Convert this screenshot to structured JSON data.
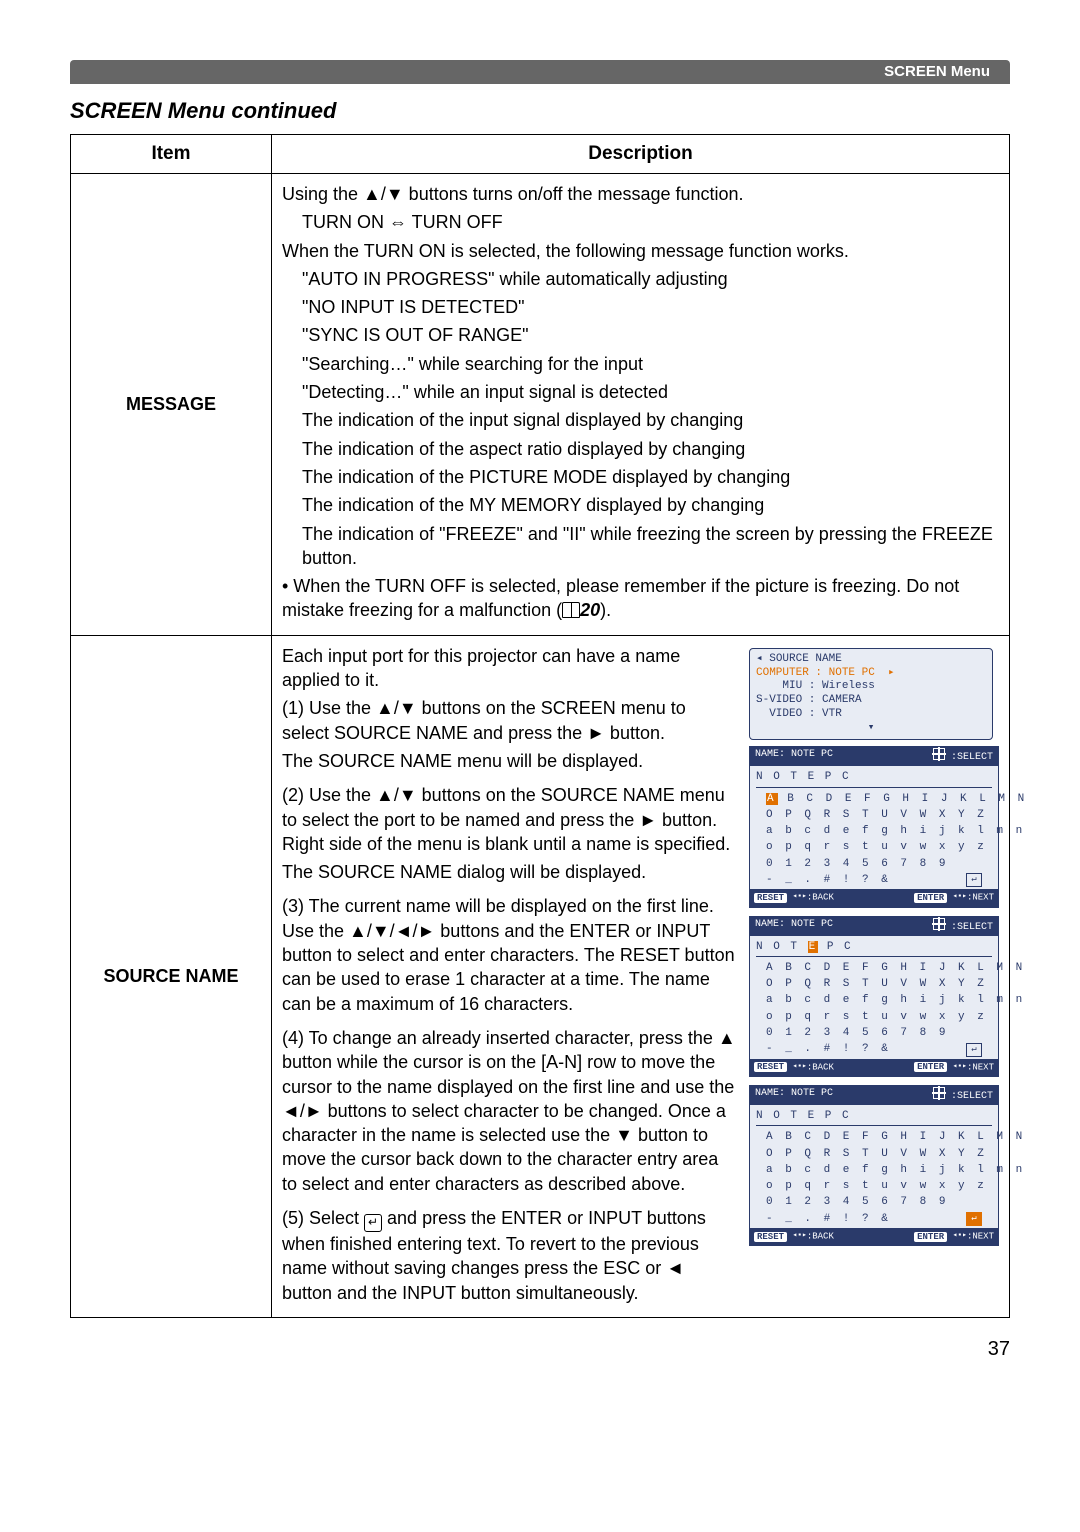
{
  "header_label": "SCREEN Menu",
  "section_title": "SCREEN Menu continued",
  "table": {
    "col_item": "Item",
    "col_desc": "Description"
  },
  "message": {
    "item": "MESSAGE",
    "p1": "Using the ▲/▼ buttons turns on/off the message function.",
    "p2": "TURN ON ⇔ TURN OFF",
    "p3": "When the TURN ON is selected, the following message function works.",
    "b1": "\"AUTO IN PROGRESS\" while automatically adjusting",
    "b2": "\"NO INPUT IS DETECTED\"",
    "b3": "\"SYNC IS OUT OF RANGE\"",
    "b4": "\"Searching…\" while searching for the input",
    "b5": "\"Detecting…\" while an input signal is detected",
    "b6": "The indication of the input signal displayed by changing",
    "b7": "The indication of the aspect ratio displayed by changing",
    "b8": "The indication of the PICTURE MODE displayed by changing",
    "b9": "The indication of the MY MEMORY displayed by changing",
    "b10": "The indication of \"FREEZE\" and \"II\" while freezing the screen by pressing the FREEZE button.",
    "note_a": "• When the TURN OFF is selected, please remember if the picture is freezing. Do not mistake freezing for a malfunction (",
    "note_ref": "20",
    "note_b": ")."
  },
  "source": {
    "item": "SOURCE NAME",
    "p0": "Each input port for this projector can have a name applied to it.",
    "p1a": "(1) Use the ▲/▼ buttons on the SCREEN menu to select SOURCE NAME and press the ► button.",
    "p1b": "The SOURCE NAME menu will be displayed.",
    "p2a": "(2) Use the ▲/▼ buttons on the SOURCE NAME menu to select the port to be named and press the ► button. Right side of the menu is blank until a name is specified.",
    "p2b": "The SOURCE NAME dialog will be displayed.",
    "p3": "(3) The current name will be displayed on the first line. Use the ▲/▼/◄/► buttons and the ENTER or INPUT button to select and enter characters. The RESET button can be used to erase 1 character at a time. The name can be a maximum of 16 characters.",
    "p4": "(4) To change an already inserted character, press the ▲ button while the cursor is on the [A-N] row to move the cursor to the name displayed on the first line and use the ◄/► buttons to select character to be changed. Once a character in the name is selected use the ▼ button to move the cursor back down to the character entry area to select and enter characters as described above.",
    "p5a": "(5) Select ",
    "p5b": " and press the ENTER or INPUT buttons when finished entering text. To revert to the previous name without saving changes press the ESC or ◄ button and the INPUT button simultaneously."
  },
  "osd_menu": {
    "title": "◂ SOURCE NAME",
    "sel": "COMPUTER : NOTE PC  ▸",
    "r1": "    MIU : Wireless",
    "r2": "S-VIDEO : CAMERA",
    "r3": "  VIDEO : VTR"
  },
  "osd_dialog": {
    "hdr_left": "NAME: NOTE PC",
    "hdr_right_label": ":SELECT",
    "name1": "N O T E  P C",
    "name2_pre": "N O T",
    "name2_hl": "E",
    "name2_post": "  P C",
    "row_AN": "A B C D E F G H I J K L M N",
    "row_OZ": "O P Q R S T U V W X Y Z",
    "row_an": "a b c d e f g h i j k l m n",
    "row_oz": "o p q r s t u v w x y z",
    "row_09": "0 1 2 3 4 5 6 7 8 9",
    "row_sym": "- _ . # ! ? &",
    "ftr_reset": "RESET",
    "ftr_back": ":BACK",
    "ftr_enter": "ENTER",
    "ftr_next": ":NEXT"
  },
  "page_number": "37"
}
